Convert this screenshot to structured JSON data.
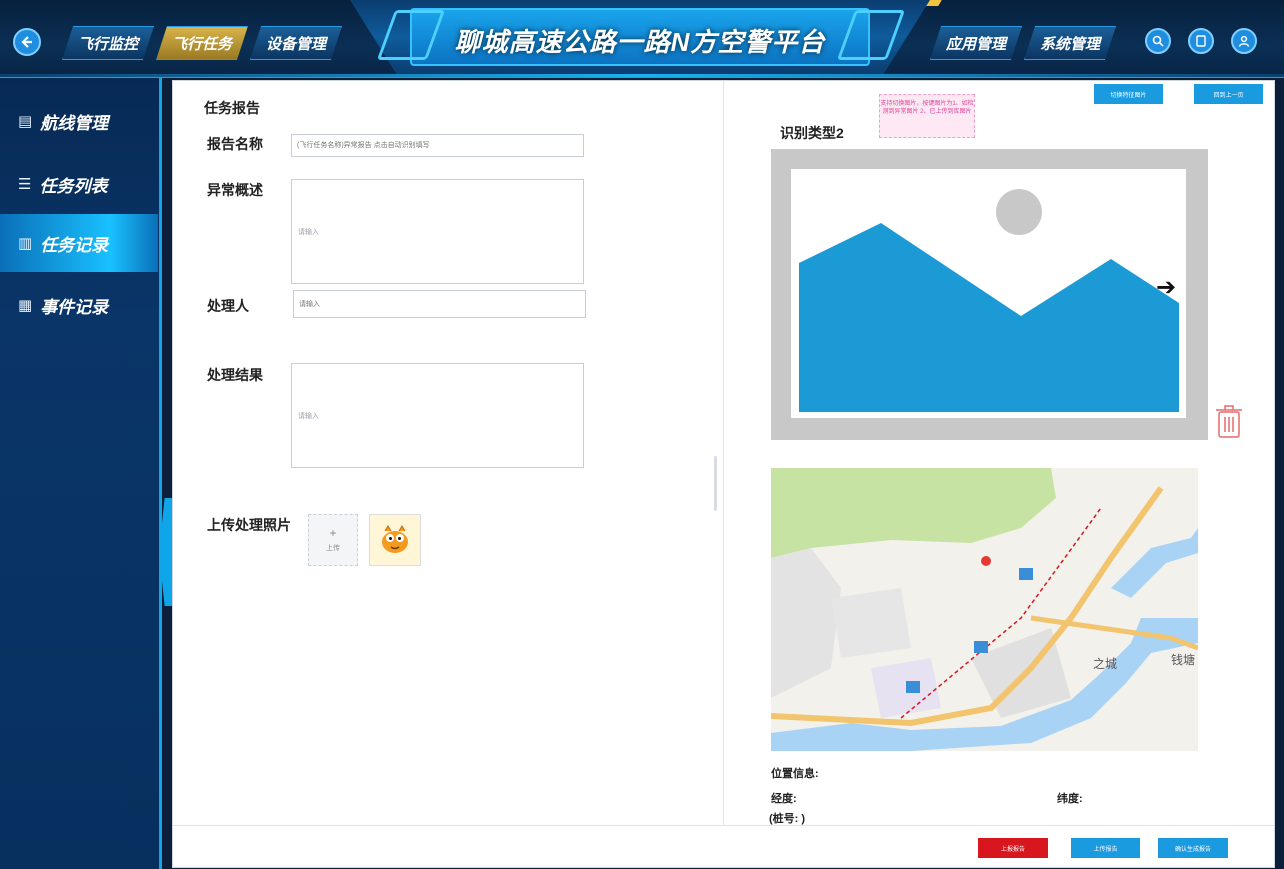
{
  "header": {
    "title": "聊城高速公路一路N方空警平台",
    "nav_left": [
      "飞行监控",
      "飞行任务",
      "设备管理"
    ],
    "nav_right": [
      "应用管理",
      "系统管理"
    ],
    "active_nav": "飞行任务"
  },
  "sidebar": {
    "items": [
      {
        "label": "航线管理",
        "icon": "route-doc-icon"
      },
      {
        "label": "任务列表",
        "icon": "list-icon"
      },
      {
        "label": "任务记录",
        "icon": "record-doc-icon"
      },
      {
        "label": "事件记录",
        "icon": "event-doc-icon"
      }
    ],
    "active": "任务记录"
  },
  "report": {
    "section_title": "任务报告",
    "name_label": "报告名称",
    "name_placeholder": "(飞行任务名称)异常报告 点击自动识别填写",
    "anomaly_label": "异常概述",
    "anomaly_placeholder": "请输入",
    "handler_label": "处理人",
    "handler_placeholder": "请输入",
    "result_label": "处理结果",
    "result_placeholder": "请输入",
    "upload_label": "上传处理照片",
    "upload_text": "上传",
    "upload_plus": "+"
  },
  "recognition": {
    "btn_switch": "切换特征图片",
    "btn_prev": "回到上一页",
    "hint": "支持切换图片，按键图片为1、如检测到异常图片 2、已上传到库图片",
    "type_title": "识别类型2",
    "next_arrow": "➔"
  },
  "location": {
    "title": "位置信息:",
    "lon_label": "经度:",
    "lat_label": "纬度:",
    "stake_label": "(桩号: )"
  },
  "map_labels": {
    "city": "之城",
    "town": "钱塘"
  },
  "footer": {
    "btn_report": "上报报告",
    "btn_upload": "上传报告",
    "btn_confirm": "确认生成报告"
  },
  "colors": {
    "accent_blue": "#1a9be0",
    "danger_red": "#d7161e",
    "active_gold": "#c9a13c"
  }
}
